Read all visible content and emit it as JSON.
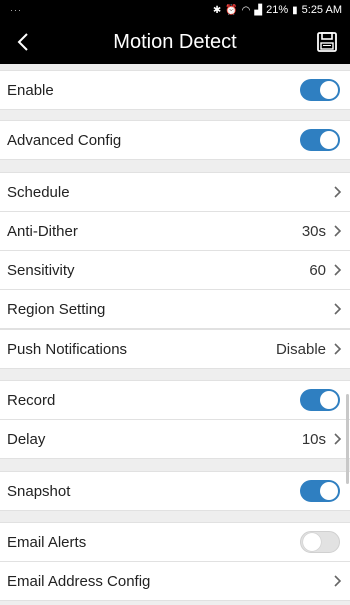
{
  "status_bar": {
    "battery": "21%",
    "time": "5:25 AM"
  },
  "header": {
    "title": "Motion Detect"
  },
  "settings": {
    "enable": {
      "label": "Enable",
      "on": true
    },
    "advanced_config": {
      "label": "Advanced Config",
      "on": true
    },
    "schedule": {
      "label": "Schedule"
    },
    "anti_dither": {
      "label": "Anti-Dither",
      "value": "30s"
    },
    "sensitivity": {
      "label": "Sensitivity",
      "value": "60"
    },
    "region_setting": {
      "label": "Region Setting"
    },
    "push_notifications": {
      "label": "Push Notifications",
      "value": "Disable"
    },
    "record": {
      "label": "Record",
      "on": true
    },
    "delay": {
      "label": "Delay",
      "value": "10s"
    },
    "snapshot": {
      "label": "Snapshot",
      "on": true
    },
    "email_alerts": {
      "label": "Email Alerts",
      "on": false
    },
    "email_address_config": {
      "label": "Email Address Config"
    }
  },
  "colors": {
    "toggle_on": "#2f7fc1",
    "toggle_off": "#e2e2e2",
    "header_bg": "#000000",
    "page_bg": "#eeeeee"
  }
}
